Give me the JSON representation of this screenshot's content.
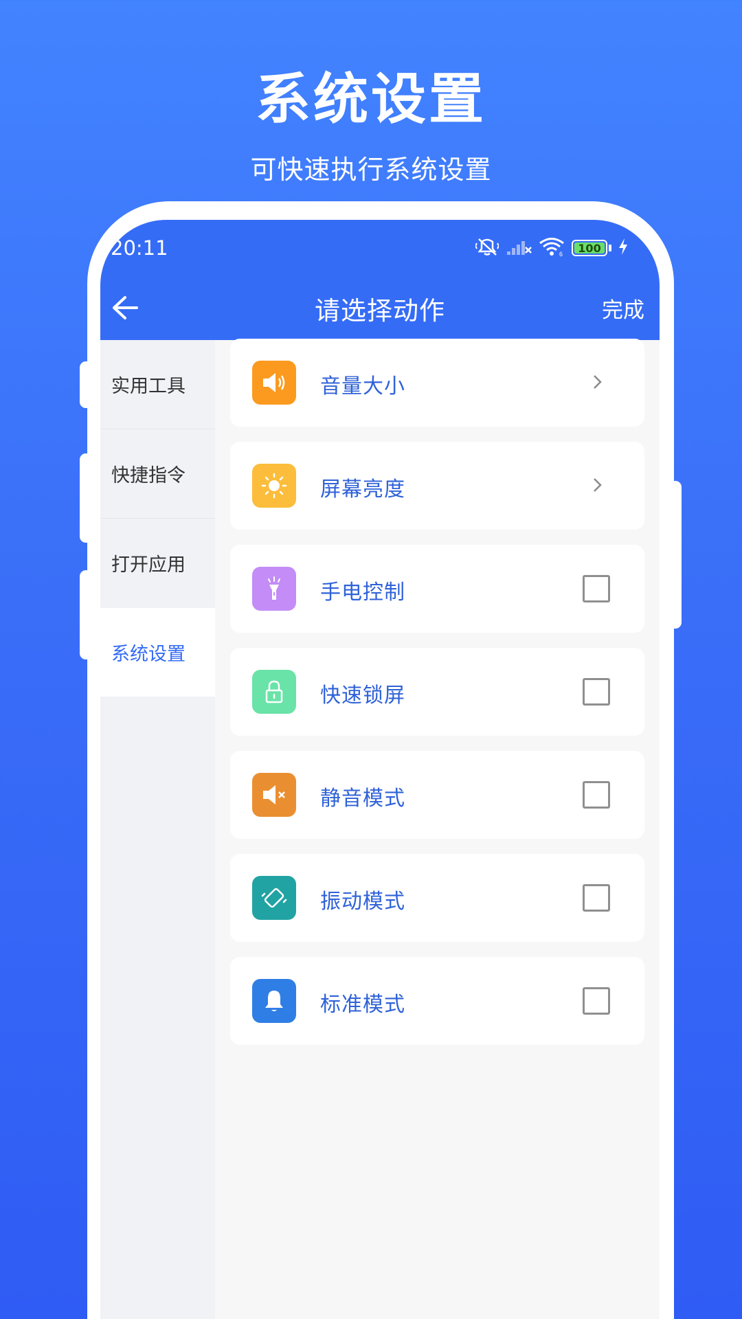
{
  "hero": {
    "title": "系统设置",
    "subtitle": "可快速执行系统设置"
  },
  "status_bar": {
    "time": "20:11",
    "battery": "100",
    "icons": [
      "mute-vibrate-icon",
      "signal-icon",
      "wifi-icon",
      "battery-icon",
      "charging-icon"
    ]
  },
  "nav": {
    "title": "请选择动作",
    "done_label": "完成",
    "back_icon": "back-arrow-icon"
  },
  "sidebar": {
    "items": [
      {
        "label": "实用工具",
        "active": false
      },
      {
        "label": "快捷指令",
        "active": false
      },
      {
        "label": "打开应用",
        "active": false
      },
      {
        "label": "系统设置",
        "active": true
      }
    ]
  },
  "actions": {
    "items": [
      {
        "label": "音量大小",
        "icon": "speaker-icon",
        "color": "#fb9a1f",
        "control": "arrow"
      },
      {
        "label": "屏幕亮度",
        "icon": "brightness-icon",
        "color": "#fbbd3b",
        "control": "arrow"
      },
      {
        "label": "手电控制",
        "icon": "flashlight-icon",
        "color": "#c38cf7",
        "control": "checkbox",
        "checked": false
      },
      {
        "label": "快速锁屏",
        "icon": "lock-icon",
        "color": "#69e3a7",
        "control": "checkbox",
        "checked": false
      },
      {
        "label": "静音模式",
        "icon": "mute-icon",
        "color": "#ea8f31",
        "control": "checkbox",
        "checked": false
      },
      {
        "label": "振动模式",
        "icon": "vibrate-icon",
        "color": "#22a3a3",
        "control": "checkbox",
        "checked": false
      },
      {
        "label": "标准模式",
        "icon": "bell-icon",
        "color": "#2f7ee6",
        "control": "checkbox",
        "checked": false
      }
    ]
  },
  "colors": {
    "primary": "#356cf6",
    "label": "#2f62d8",
    "background_top": "#4283ff",
    "background_bottom": "#2f5cf4"
  }
}
